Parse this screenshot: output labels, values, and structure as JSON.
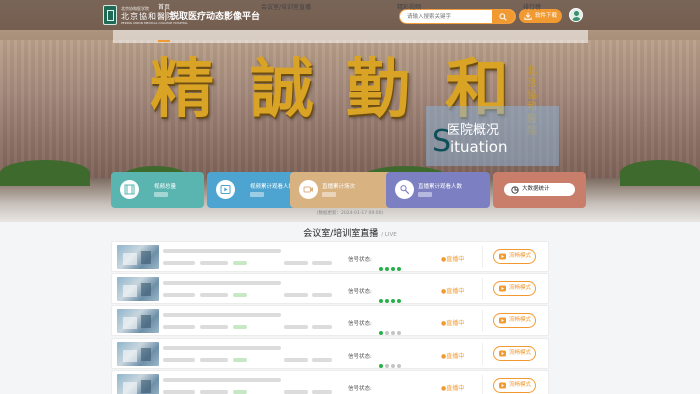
{
  "header": {
    "logo_small": "北京协和医学院",
    "logo_main": "北京協和醫院",
    "logo_en": "PEKING UNION MEDICAL COLLEGE HOSPITAL",
    "title": "锐取医疗动态影像平台",
    "search_placeholder": "请输入搜索关键字",
    "download_label": "软件下载"
  },
  "nav": {
    "items": [
      {
        "label": "首页",
        "active": true
      },
      {
        "label": "会议室/培训室直播",
        "active": false
      },
      {
        "label": "精彩视频",
        "active": false
      },
      {
        "label": "排行榜",
        "active": false
      }
    ]
  },
  "hero": {
    "characters": [
      "精",
      "誠",
      "勤",
      "和"
    ],
    "side_inscription": "北京協和醫院",
    "overlay": {
      "cn": "医院概况",
      "en_first": "S",
      "en_rest": "ituation"
    }
  },
  "stats": {
    "cards": [
      {
        "label": "视频总量",
        "color": "#5ab5b0",
        "icon": "film-icon"
      },
      {
        "label": "视频累计观看人数",
        "color": "#4da4d0",
        "icon": "play-icon"
      },
      {
        "label": "直播累计场次",
        "color": "#d9b282",
        "icon": "camera-icon"
      },
      {
        "label": "直播累计观看人数",
        "color": "#7c7fc1",
        "icon": "people-icon"
      }
    ],
    "big_data_label": "大数据统计",
    "big_data_color": "#c97d6b",
    "update_text": "(数据更新：2024-01-17 09:00)"
  },
  "section": {
    "title": "会议室/培训室直播",
    "subtitle": "/ LIVE"
  },
  "rooms": {
    "signal_label": "信号状态:",
    "live_label": "●直播中",
    "mode_label": "流畅模式",
    "rows": [
      {
        "signal": [
          1,
          1,
          1,
          1
        ]
      },
      {
        "signal": [
          1,
          1,
          1,
          1
        ]
      },
      {
        "signal": [
          1,
          0,
          0,
          0
        ]
      },
      {
        "signal": [
          1,
          0,
          0,
          0
        ]
      },
      {
        "signal": [
          1,
          0,
          0,
          0
        ]
      }
    ]
  },
  "colors": {
    "accent": "#f29a32",
    "signal_on": "#27b14a",
    "signal_off": "#c5c5c5"
  }
}
